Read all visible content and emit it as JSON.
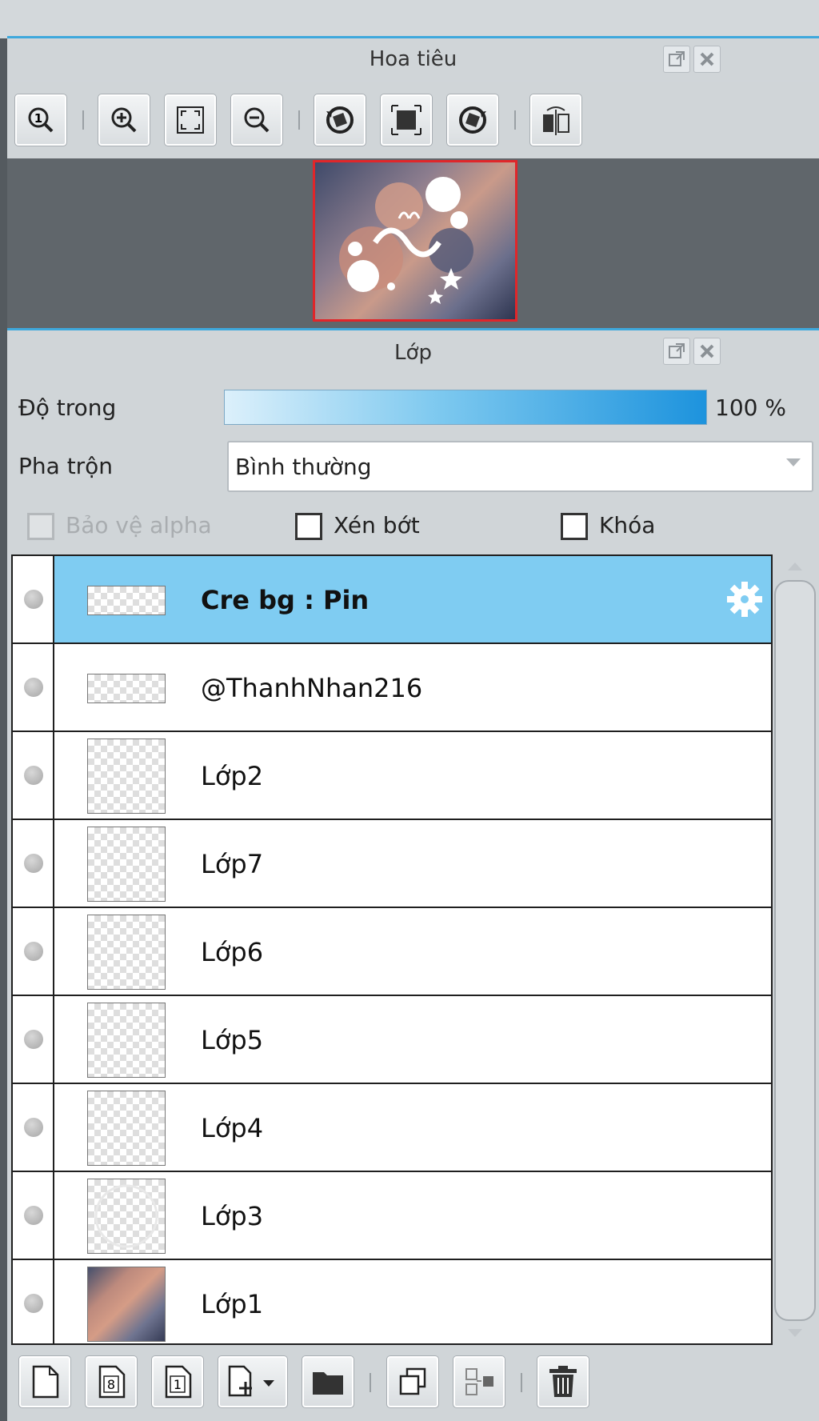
{
  "navigator": {
    "title": "Hoa tiêu",
    "toolbar": [
      {
        "name": "zoom-actual-size-icon"
      },
      {
        "name": "zoom-in-icon"
      },
      {
        "name": "fit-to-window-icon"
      },
      {
        "name": "zoom-out-icon"
      },
      {
        "name": "rotate-left-icon"
      },
      {
        "name": "reset-rotation-icon"
      },
      {
        "name": "rotate-right-icon"
      },
      {
        "name": "flip-horizontal-icon"
      }
    ]
  },
  "layers_panel": {
    "title": "Lớp",
    "opacity_label": "Độ trong",
    "opacity_value": "100 %",
    "opacity_level": 1.0,
    "blend_label": "Pha trộn",
    "blend_value": "Bình thường",
    "protect_alpha_label": "Bảo vệ alpha",
    "clipping_label": "Xén bớt",
    "lock_label": "Khóa",
    "layers": [
      {
        "name": "Cre bg : Pin",
        "selected": true,
        "thumb": "wide"
      },
      {
        "name": "@ThanhNhan216",
        "selected": false,
        "thumb": "wide"
      },
      {
        "name": "Lớp2",
        "selected": false,
        "thumb": "square"
      },
      {
        "name": "Lớp7",
        "selected": false,
        "thumb": "square"
      },
      {
        "name": "Lớp6",
        "selected": false,
        "thumb": "square"
      },
      {
        "name": "Lớp5",
        "selected": false,
        "thumb": "square"
      },
      {
        "name": "Lớp4",
        "selected": false,
        "thumb": "square"
      },
      {
        "name": "Lớp3",
        "selected": false,
        "thumb": "square"
      },
      {
        "name": "Lớp1",
        "selected": false,
        "thumb": "photo"
      }
    ],
    "bottom_toolbar": [
      {
        "name": "new-layer-icon"
      },
      {
        "name": "new-8bit-layer-icon",
        "glyph": "8"
      },
      {
        "name": "new-1bit-layer-icon",
        "glyph": "1"
      },
      {
        "name": "add-layer-dropdown-icon"
      },
      {
        "name": "new-folder-icon"
      },
      {
        "name": "duplicate-layer-icon"
      },
      {
        "name": "merge-down-icon"
      },
      {
        "name": "delete-layer-icon"
      }
    ]
  },
  "colors": {
    "accent": "#3ea8dc",
    "selection": "#7fccf2",
    "preview_border": "#e0262a"
  }
}
